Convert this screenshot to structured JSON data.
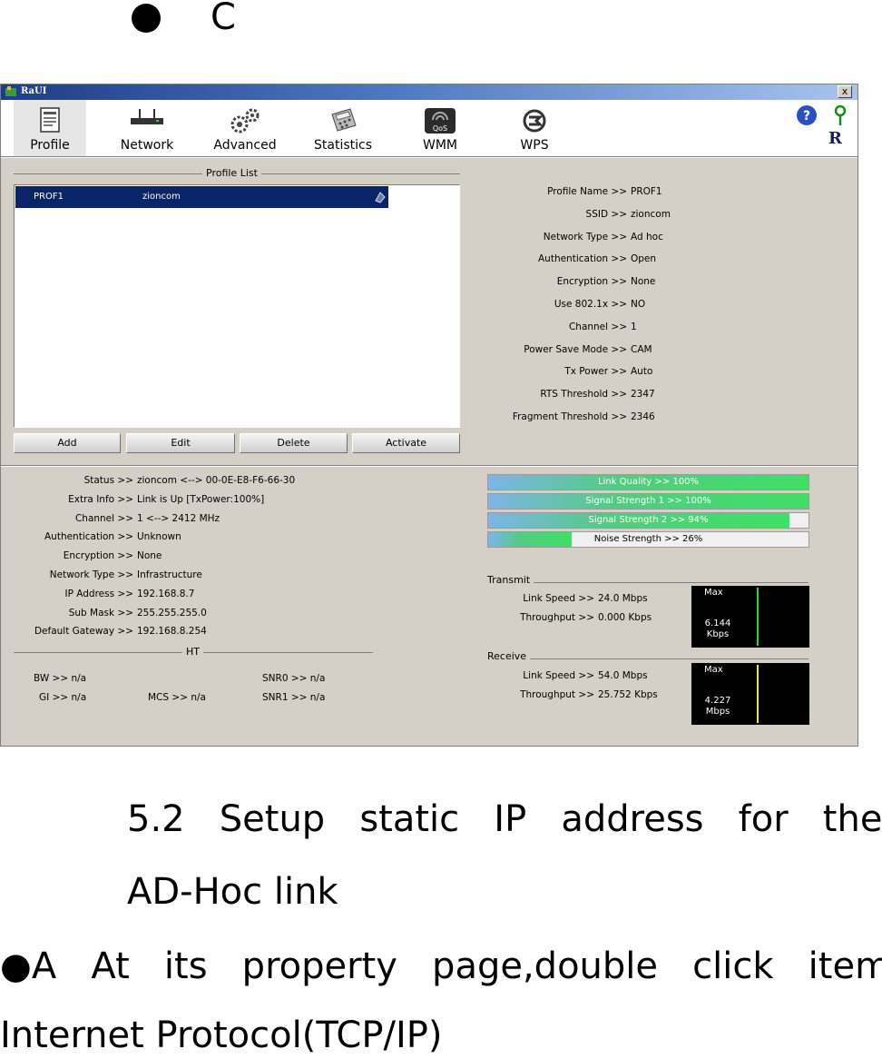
{
  "page": {
    "top_letter": "C",
    "heading_line1": "5.2   Setup   static   IP   address   for   the",
    "heading_line2": "AD-Hoc link",
    "para_line1": "●A   At   its   property   page,double   click   item",
    "para_line2": "Internet Protocol(TCP/IP)"
  },
  "window": {
    "title": "RaUI",
    "close_label": "x",
    "toolbar": [
      {
        "label": "Profile",
        "icon": "profile-icon"
      },
      {
        "label": "Network",
        "icon": "network-icon"
      },
      {
        "label": "Advanced",
        "icon": "advanced-gears-icon"
      },
      {
        "label": "Statistics",
        "icon": "statistics-calculator-icon"
      },
      {
        "label": "WMM",
        "icon": "wmm-qos-icon"
      },
      {
        "label": "WPS",
        "icon": "wps-icon"
      }
    ],
    "help_icon": "help-icon",
    "about_icon": "about-r-icon",
    "about_letter": "R",
    "profile_list": {
      "title": "Profile List",
      "rows": [
        {
          "name": "PROF1",
          "ssid": "zioncom",
          "icon": "adhoc-profile-icon"
        }
      ],
      "buttons": {
        "add": "Add",
        "edit": "Edit",
        "delete": "Delete",
        "activate": "Activate"
      }
    },
    "profile_details": [
      {
        "label": "Profile Name >>",
        "value": "PROF1"
      },
      {
        "label": "SSID >>",
        "value": "zioncom"
      },
      {
        "label": "Network Type >>",
        "value": "Ad hoc"
      },
      {
        "label": "Authentication >>",
        "value": "Open"
      },
      {
        "label": "Encryption >>",
        "value": "None"
      },
      {
        "label": "Use 802.1x >>",
        "value": "NO"
      },
      {
        "label": "Channel >>",
        "value": "1"
      },
      {
        "label": "Power Save Mode >>",
        "value": "CAM"
      },
      {
        "label": "Tx Power >>",
        "value": "Auto"
      },
      {
        "label": "RTS Threshold >>",
        "value": "2347"
      },
      {
        "label": "Fragment Threshold >>",
        "value": "2346"
      }
    ],
    "status": [
      {
        "label": "Status >>",
        "value": "zioncom <--> 00-0E-E8-F6-66-30"
      },
      {
        "label": "Extra Info >>",
        "value": "Link is Up [TxPower:100%]"
      },
      {
        "label": "Channel >>",
        "value": "1 <--> 2412 MHz"
      },
      {
        "label": "Authentication >>",
        "value": "Unknown"
      },
      {
        "label": "Encryption >>",
        "value": "None"
      },
      {
        "label": "Network Type >>",
        "value": "Infrastructure"
      },
      {
        "label": "IP Address >>",
        "value": "192.168.8.7"
      },
      {
        "label": "Sub Mask >>",
        "value": "255.255.255.0"
      },
      {
        "label": "Default Gateway >>",
        "value": "192.168.8.254"
      }
    ],
    "ht": {
      "title": "HT",
      "bw": "BW >> n/a",
      "gi": "GI >> n/a",
      "mcs": "MCS >> n/a",
      "snr0": "SNR0 >> n/a",
      "snr1": "SNR1 >> n/a"
    },
    "bars": [
      {
        "label": "Link Quality >> 100%",
        "percent": 100,
        "dark": false
      },
      {
        "label": "Signal Strength 1 >> 100%",
        "percent": 100,
        "dark": false
      },
      {
        "label": "Signal Strength 2 >> 94%",
        "percent": 94,
        "dark": false
      },
      {
        "label": "Noise Strength >> 26%",
        "percent": 26,
        "dark": true
      }
    ],
    "transmit": {
      "title": "Transmit",
      "link_speed_label": "Link Speed >>",
      "link_speed": "24.0 Mbps",
      "throughput_label": "Throughput >>",
      "throughput": "0.000 Kbps",
      "graph_max": "Max",
      "graph_value": "6.144",
      "graph_unit": "Kbps",
      "graph_color": "#22dd22"
    },
    "receive": {
      "title": "Receive",
      "link_speed_label": "Link Speed >>",
      "link_speed": "54.0 Mbps",
      "throughput_label": "Throughput >>",
      "throughput": "25.752 Kbps",
      "graph_max": "Max",
      "graph_value": "4.227",
      "graph_unit": "Mbps",
      "graph_color": "#f0e050"
    },
    "colors": {
      "selection": "#0a246a",
      "title_bar": "#1e3c8a"
    }
  }
}
